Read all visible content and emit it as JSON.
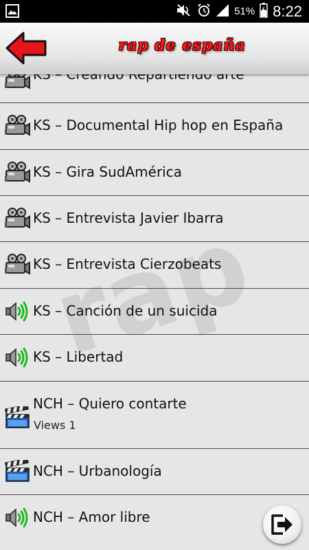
{
  "status_bar": {
    "battery_percent": "51%",
    "time": "8:22",
    "icons": [
      "screenshot-icon",
      "mute-icon",
      "alarm-icon",
      "signal-icon",
      "battery-icon"
    ]
  },
  "header": {
    "title": "rap de españa",
    "back_icon": "arrow-left-icon"
  },
  "watermark_text": "rap",
  "list": {
    "items": [
      {
        "icon": "video-camera-icon",
        "title": "KS – Creando Repartiendo arte",
        "subtitle": ""
      },
      {
        "icon": "video-camera-icon",
        "title": "KS – Documental Hip hop en España",
        "subtitle": ""
      },
      {
        "icon": "video-camera-icon",
        "title": "KS – Gira SudAmérica",
        "subtitle": ""
      },
      {
        "icon": "video-camera-icon",
        "title": "KS – Entrevista Javier Ibarra",
        "subtitle": ""
      },
      {
        "icon": "video-camera-icon",
        "title": "KS – Entrevista Cierzobeats",
        "subtitle": ""
      },
      {
        "icon": "speaker-icon",
        "title": "KS – Canción de un suicida",
        "subtitle": ""
      },
      {
        "icon": "speaker-icon",
        "title": "KS – Libertad",
        "subtitle": ""
      },
      {
        "icon": "clapperboard-icon",
        "title": "NCH – Quiero contarte",
        "subtitle": "Views 1"
      },
      {
        "icon": "clapperboard-icon",
        "title": "NCH – Urbanología",
        "subtitle": ""
      },
      {
        "icon": "speaker-icon",
        "title": "NCH – Amor libre",
        "subtitle": ""
      }
    ]
  },
  "exit_button_icon": "exit-icon",
  "colors": {
    "status_bar_bg": "#000000",
    "header_title": "#ff1a1a",
    "back_arrow": "#e8141c",
    "list_bg": "#e6e6e6",
    "divider": "#4a4a4a"
  }
}
